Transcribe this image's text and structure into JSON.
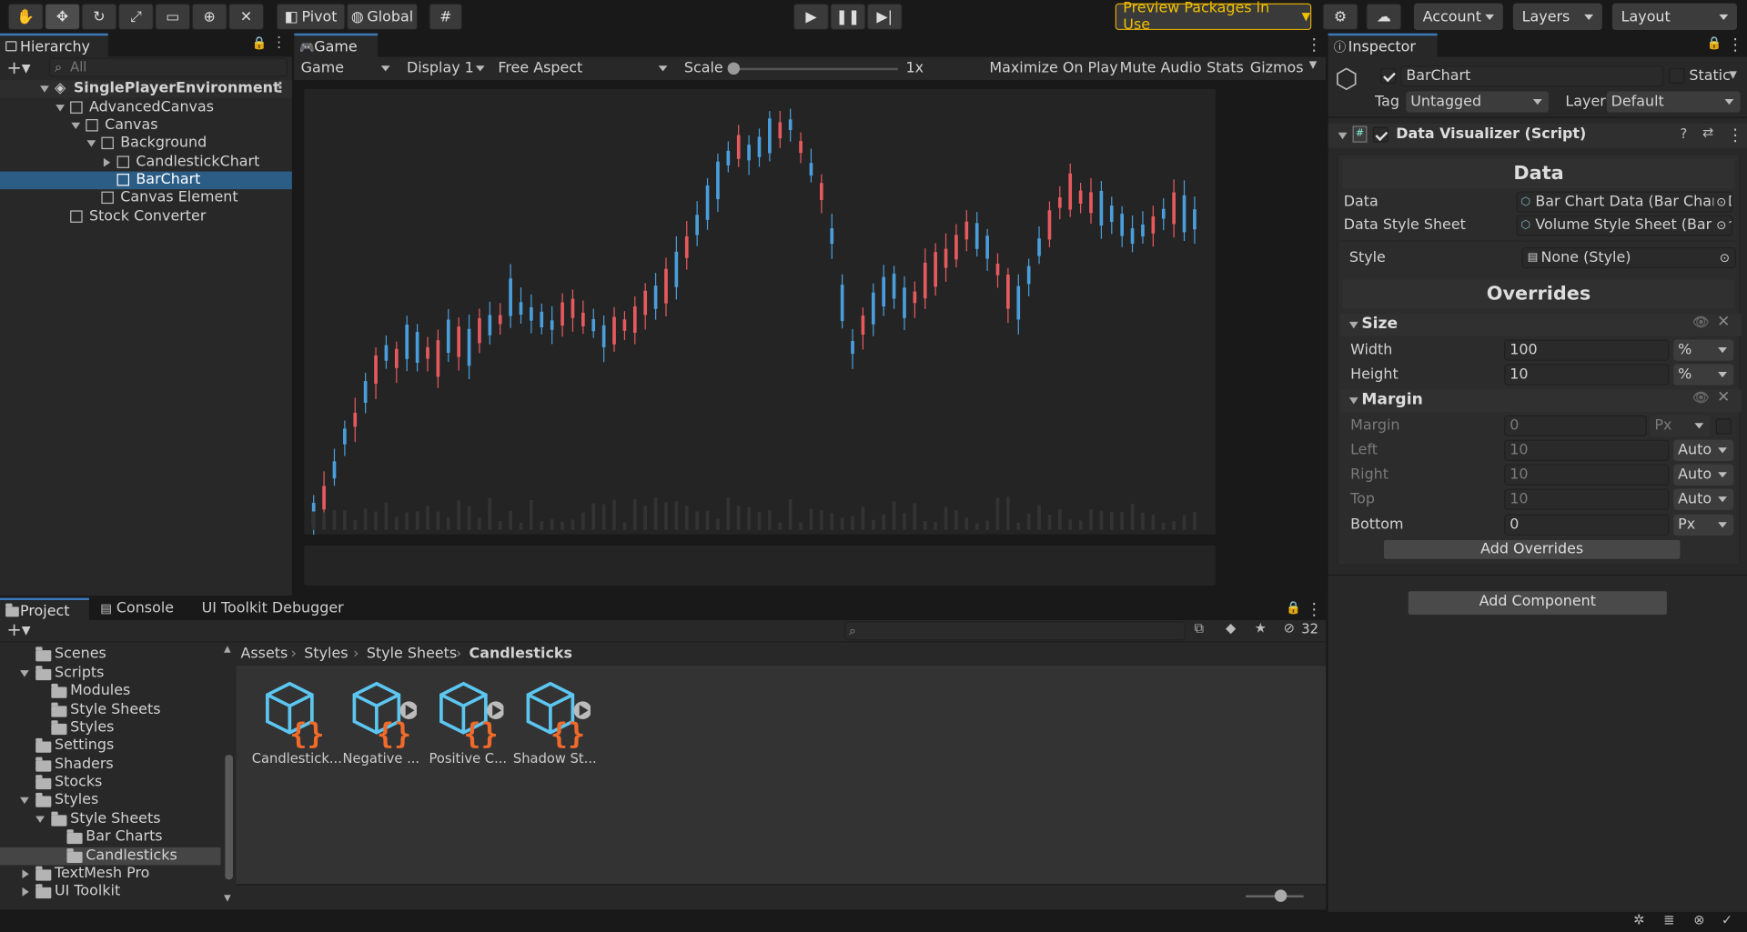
{
  "toolbar": {
    "pivot": "Pivot",
    "global": "Global",
    "preview": "Preview Packages in Use",
    "account": "Account",
    "layers": "Layers",
    "layout": "Layout"
  },
  "hierarchy": {
    "tab": "Hierarchy",
    "search_placeholder": "All",
    "items": [
      "SinglePlayerEnvironment",
      "AdvancedCanvas",
      "Canvas",
      "Background",
      "CandlestickChart",
      "BarChart",
      "Canvas Element",
      "Stock Converter"
    ]
  },
  "game": {
    "tab": "Game",
    "mode": "Game",
    "display": "Display 1",
    "aspect": "Free Aspect",
    "scale_label": "Scale",
    "scale_value": "1x",
    "maximize": "Maximize On Play",
    "mute": "Mute Audio",
    "stats": "Stats",
    "gizmos": "Gizmos"
  },
  "inspector": {
    "tab": "Inspector",
    "name": "BarChart",
    "static": "Static",
    "tag_label": "Tag",
    "tag": "Untagged",
    "layer_label": "Layer",
    "layer": "Default",
    "component": "Data Visualizer (Script)",
    "data_header": "Data",
    "data_label": "Data",
    "data_value": "Bar Chart Data (Bar Chart D",
    "style_sheet_label": "Data Style Sheet",
    "style_sheet_value": "Volume Style Sheet (Bar Ch",
    "style_label": "Style",
    "style_value": "None (Style)",
    "overrides": "Overrides",
    "size": "Size",
    "width_label": "Width",
    "width": "100",
    "width_unit": "%",
    "height_label": "Height",
    "height": "10",
    "height_unit": "%",
    "margin": "Margin",
    "margin_label": "Margin",
    "margin_value": "0",
    "margin_unit": "Px",
    "left_label": "Left",
    "left": "10",
    "left_unit": "Auto",
    "right_label": "Right",
    "right": "10",
    "right_unit": "Auto",
    "top_label": "Top",
    "top": "10",
    "top_unit": "Auto",
    "bottom_label": "Bottom",
    "bottom": "0",
    "bottom_unit": "Px",
    "add_overrides": "Add Overrides",
    "add_component": "Add Component"
  },
  "project": {
    "tabs": [
      "Project",
      "Console",
      "UI Toolkit Debugger"
    ],
    "count": "32",
    "tree": [
      "Scenes",
      "Scripts",
      "Modules",
      "Style Sheets",
      "Styles",
      "Settings",
      "Shaders",
      "Stocks",
      "Styles",
      "Style Sheets",
      "Bar Charts",
      "Candlesticks",
      "TextMesh Pro",
      "UI Toolkit"
    ],
    "breadcrumb": [
      "Assets",
      "Styles",
      "Style Sheets",
      "Candlesticks"
    ],
    "assets": [
      "Candlestick...",
      "Negative ...",
      "Positive C...",
      "Shadow St..."
    ]
  },
  "colors": {
    "up": "#4a9edb",
    "down": "#e65a5e",
    "selection": "#2c5d87",
    "preview": "#e0a800"
  }
}
